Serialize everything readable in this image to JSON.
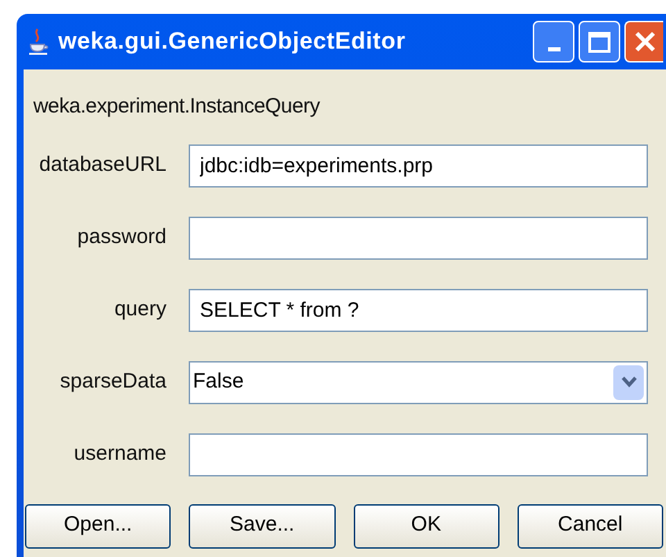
{
  "window": {
    "title": "weka.gui.GenericObjectEditor"
  },
  "class_name": "weka.experiment.InstanceQuery",
  "properties": [
    {
      "label": "databaseURL",
      "kind": "text",
      "value": "jdbc:idb=experiments.prp"
    },
    {
      "label": "password",
      "kind": "text"
    },
    {
      "label": "query",
      "kind": "text",
      "value": "SELECT * from ?"
    },
    {
      "label": "sparseData",
      "kind": "dropdown",
      "value": "False"
    },
    {
      "label": "username",
      "kind": "text"
    }
  ],
  "buttons": [
    "Open...",
    "Save...",
    "OK",
    "Cancel"
  ]
}
